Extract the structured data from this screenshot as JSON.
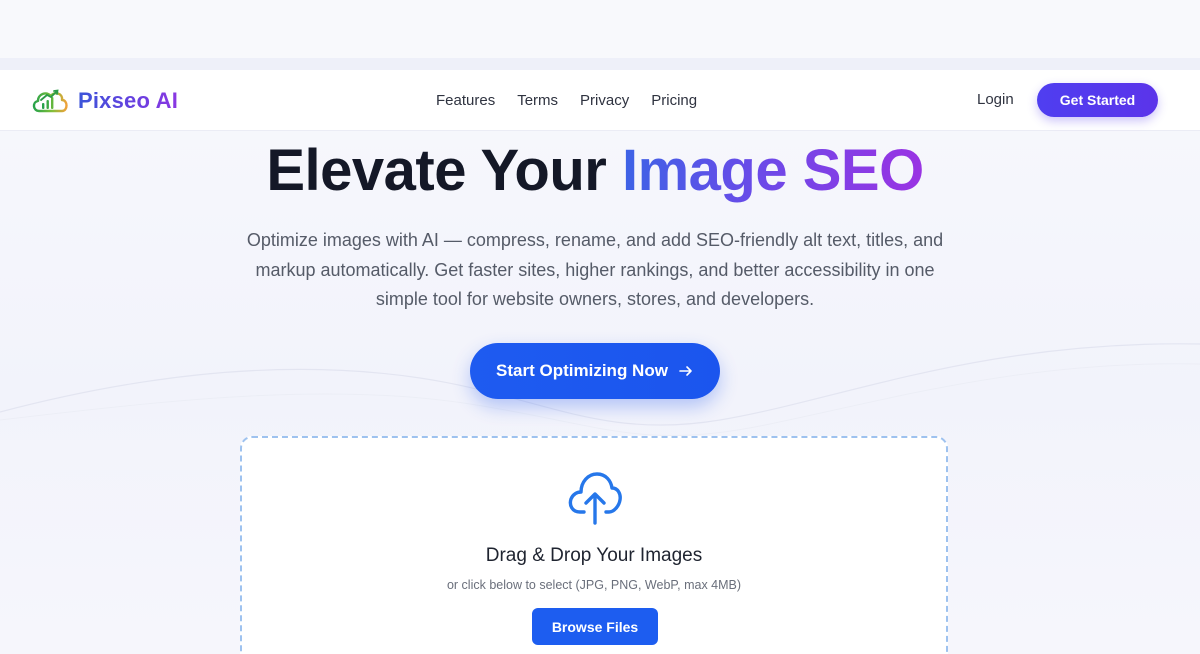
{
  "brand": {
    "name": "Pixseo AI",
    "logo_icon": "cloud-chart-logo",
    "gradient_start": "#3b55d9",
    "gradient_end": "#8b38e2"
  },
  "nav": {
    "links": [
      "Features",
      "Terms",
      "Privacy",
      "Pricing"
    ],
    "login_label": "Login",
    "cta_label": "Get Started"
  },
  "hero": {
    "title_prefix": "Elevate Your ",
    "title_accent": "Image SEO",
    "subtitle": "Optimize images with AI — compress, rename, and add SEO-friendly alt text, titles, and markup automatically. Get faster sites, higher rankings, and better accessibility in one simple tool for website owners, stores, and developers.",
    "cta_label": "Start Optimizing Now",
    "cta_icon": "arrow-right-icon"
  },
  "upload": {
    "icon": "cloud-upload-icon",
    "title": "Drag & Drop Your Images",
    "hint": "or click below to select (JPG, PNG, WebP, max 4MB)",
    "button_label": "Browse Files"
  },
  "colors": {
    "primary_blue": "#1d5df0",
    "primary_purple": "#5b34ea",
    "heading_dark": "#141827",
    "body_text": "#555b68",
    "dropzone_border": "#9ec2ef"
  }
}
